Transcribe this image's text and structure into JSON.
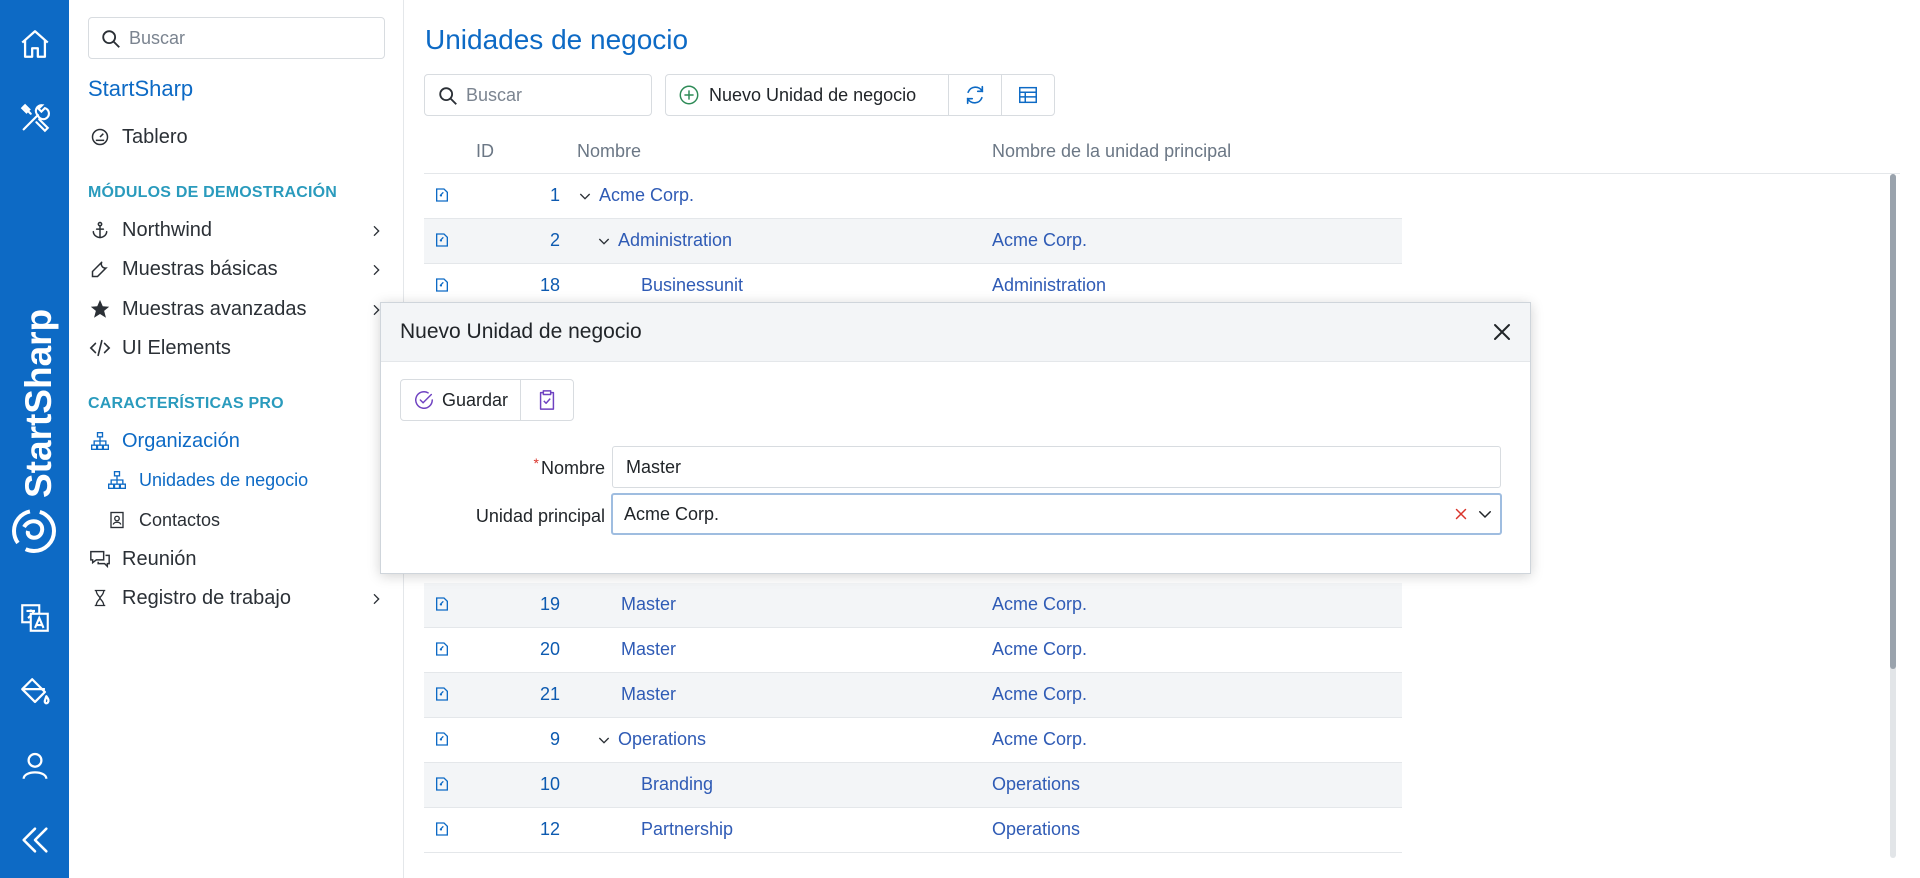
{
  "rail": {
    "brand_text": "StartSharp",
    "icons": [
      "home-icon",
      "tools-icon",
      "translate-icon",
      "paint-bucket-icon",
      "user-icon",
      "collapse-icon"
    ]
  },
  "sidebar": {
    "search_placeholder": "Buscar",
    "title": "StartSharp",
    "dashboard": "Tablero",
    "section_demo": "MÓDULOS DE DEMOSTRACIÓN",
    "items": [
      {
        "label": "Northwind",
        "icon": "anchor-icon"
      },
      {
        "label": "Muestras básicas",
        "icon": "wrench-icon"
      },
      {
        "label": "Muestras avanzadas",
        "icon": "star-icon"
      },
      {
        "label": "UI Elements",
        "icon": "code-icon"
      }
    ],
    "section_pro": "CARACTERÍSTICAS PRO",
    "organization": "Organización",
    "sub_items": [
      {
        "label": "Unidades de negocio",
        "icon": "sitemap-icon",
        "active": true
      },
      {
        "label": "Contactos",
        "icon": "contact-card-icon",
        "active": false
      }
    ],
    "items2": [
      {
        "label": "Reunión",
        "icon": "chat-icon"
      },
      {
        "label": "Registro de trabajo",
        "icon": "hourglass-icon"
      }
    ],
    "accent": "#0d6ac5",
    "section_color": "#2a9bbd"
  },
  "main": {
    "title": "Unidades de negocio",
    "search_placeholder": "Buscar",
    "new_button": "Nuevo Unidad de negocio",
    "columns": [
      "ID",
      "Nombre",
      "Nombre de la unidad principal"
    ],
    "rows": [
      {
        "id": "1",
        "name": "Acme Corp.",
        "parent": "",
        "level": 0,
        "expander": true
      },
      {
        "id": "2",
        "name": "Administration",
        "parent": "Acme Corp.",
        "level": 1,
        "expander": true
      },
      {
        "id": "18",
        "name": "Businessunit",
        "parent": "Administration",
        "level": 2,
        "expander": false
      },
      {
        "id": "19",
        "name": "Master",
        "parent": "Acme Corp.",
        "level": 1,
        "expander": false
      },
      {
        "id": "20",
        "name": "Master",
        "parent": "Acme Corp.",
        "level": 1,
        "expander": false
      },
      {
        "id": "21",
        "name": "Master",
        "parent": "Acme Corp.",
        "level": 1,
        "expander": false
      },
      {
        "id": "9",
        "name": "Operations",
        "parent": "Acme Corp.",
        "level": 1,
        "expander": true
      },
      {
        "id": "10",
        "name": "Branding",
        "parent": "Operations",
        "level": 2,
        "expander": false
      },
      {
        "id": "12",
        "name": "Partnership",
        "parent": "Operations",
        "level": 2,
        "expander": false
      }
    ]
  },
  "dialog": {
    "title": "Nuevo Unidad de negocio",
    "save_label": "Guardar",
    "required_marker": "*",
    "field_name_label": "Nombre",
    "field_name_value": "Master",
    "field_parent_label": "Unidad principal",
    "field_parent_value": "Acme Corp."
  }
}
